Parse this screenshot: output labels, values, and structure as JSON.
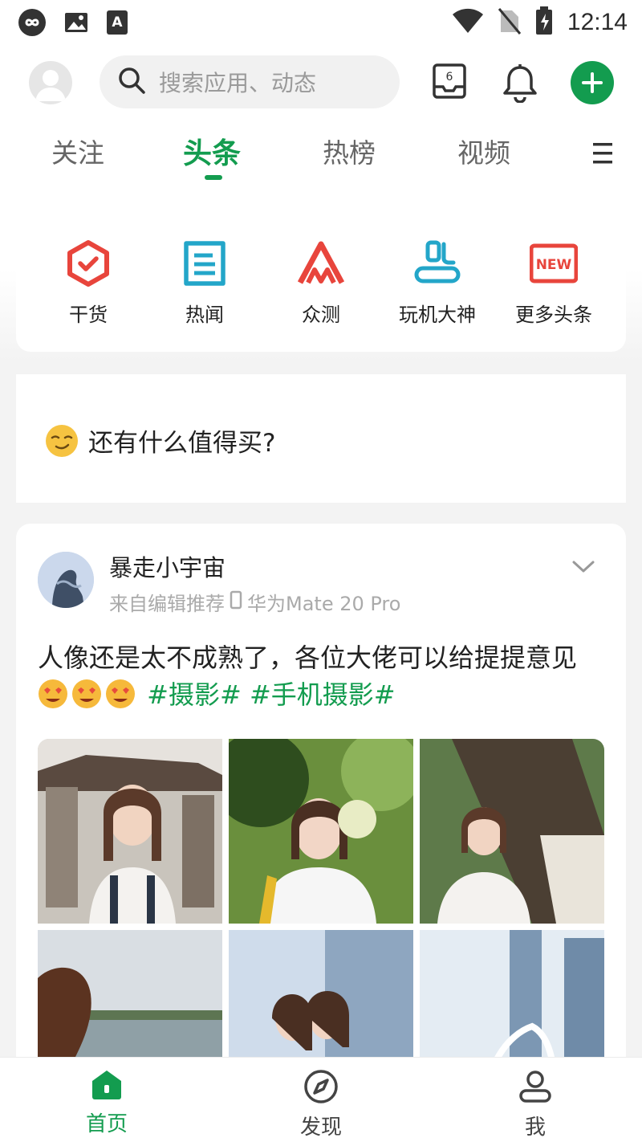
{
  "status_bar": {
    "time": "12:14",
    "icons": [
      "infinity-icon",
      "gallery-icon",
      "font-a-icon",
      "wifi-icon",
      "no-sim-icon",
      "battery-charging-icon"
    ]
  },
  "header": {
    "search_placeholder": "搜索应用、动态",
    "inbox_badge": "6",
    "icons": [
      "avatar-icon",
      "search-icon",
      "inbox-icon",
      "bell-icon",
      "add-icon"
    ]
  },
  "tabs": [
    {
      "label": "关注",
      "active": false
    },
    {
      "label": "头条",
      "active": true
    },
    {
      "label": "热榜",
      "active": false
    },
    {
      "label": "视频",
      "active": false
    }
  ],
  "quick_links": [
    {
      "label": "干货",
      "icon": "hexagon-check-icon",
      "color": "#e8453c"
    },
    {
      "label": "热闻",
      "icon": "document-icon",
      "color": "#23a6c9"
    },
    {
      "label": "众测",
      "icon": "triangle-mark-icon",
      "color": "#e8453c"
    },
    {
      "label": "玩机大神",
      "icon": "phone-user-icon",
      "color": "#23a6c9"
    },
    {
      "label": "更多头条",
      "icon": "new-badge-icon",
      "color": "#e8453c",
      "badge_text": "NEW"
    }
  ],
  "buy_prompt": {
    "text": "还有什么值得买?",
    "icon": "smirk-emoji-icon"
  },
  "post": {
    "author": "暴走小宇宙",
    "source": "来自编辑推荐",
    "device": "华为Mate 20 Pro",
    "body_text": "人像还是太不成熟了，各位大佬可以给提提意见",
    "tags": [
      "#摄影#",
      "#手机摄影#"
    ],
    "photo_count": 6
  },
  "bottom_nav": [
    {
      "label": "首页",
      "icon": "home-icon",
      "active": true
    },
    {
      "label": "发现",
      "icon": "compass-icon",
      "active": false
    },
    {
      "label": "我",
      "icon": "person-icon",
      "active": false
    }
  ],
  "colors": {
    "accent": "#139c4f",
    "red": "#e8453c",
    "teal": "#23a6c9"
  }
}
